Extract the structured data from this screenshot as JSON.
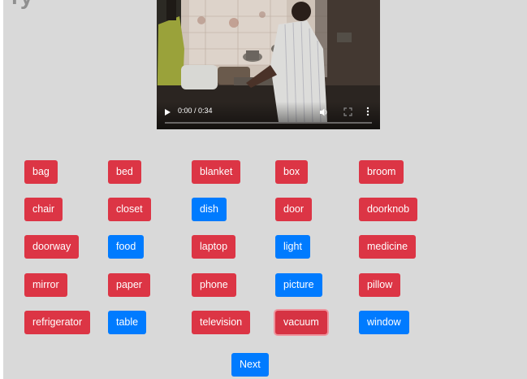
{
  "page": {
    "clipped_heading": "ry"
  },
  "video": {
    "time_display": "0:00 / 0:34",
    "progress": 0.0
  },
  "objects": [
    {
      "label": "bag",
      "color": "red"
    },
    {
      "label": "bed",
      "color": "red"
    },
    {
      "label": "blanket",
      "color": "red"
    },
    {
      "label": "box",
      "color": "red"
    },
    {
      "label": "broom",
      "color": "red"
    },
    {
      "label": "chair",
      "color": "red"
    },
    {
      "label": "closet",
      "color": "red"
    },
    {
      "label": "dish",
      "color": "blue"
    },
    {
      "label": "door",
      "color": "red"
    },
    {
      "label": "doorknob",
      "color": "red"
    },
    {
      "label": "doorway",
      "color": "red"
    },
    {
      "label": "food",
      "color": "blue"
    },
    {
      "label": "laptop",
      "color": "red"
    },
    {
      "label": "light",
      "color": "blue"
    },
    {
      "label": "medicine",
      "color": "red"
    },
    {
      "label": "mirror",
      "color": "red"
    },
    {
      "label": "paper",
      "color": "red"
    },
    {
      "label": "phone",
      "color": "red"
    },
    {
      "label": "picture",
      "color": "blue"
    },
    {
      "label": "pillow",
      "color": "red"
    },
    {
      "label": "refrigerator",
      "color": "red"
    },
    {
      "label": "table",
      "color": "blue"
    },
    {
      "label": "television",
      "color": "red"
    },
    {
      "label": "vacuum",
      "color": "red",
      "focused": true
    },
    {
      "label": "window",
      "color": "blue"
    }
  ],
  "next_label": "Next",
  "colors": {
    "red": "#dc3545",
    "blue": "#007bff",
    "background": "#d9d9d9"
  }
}
